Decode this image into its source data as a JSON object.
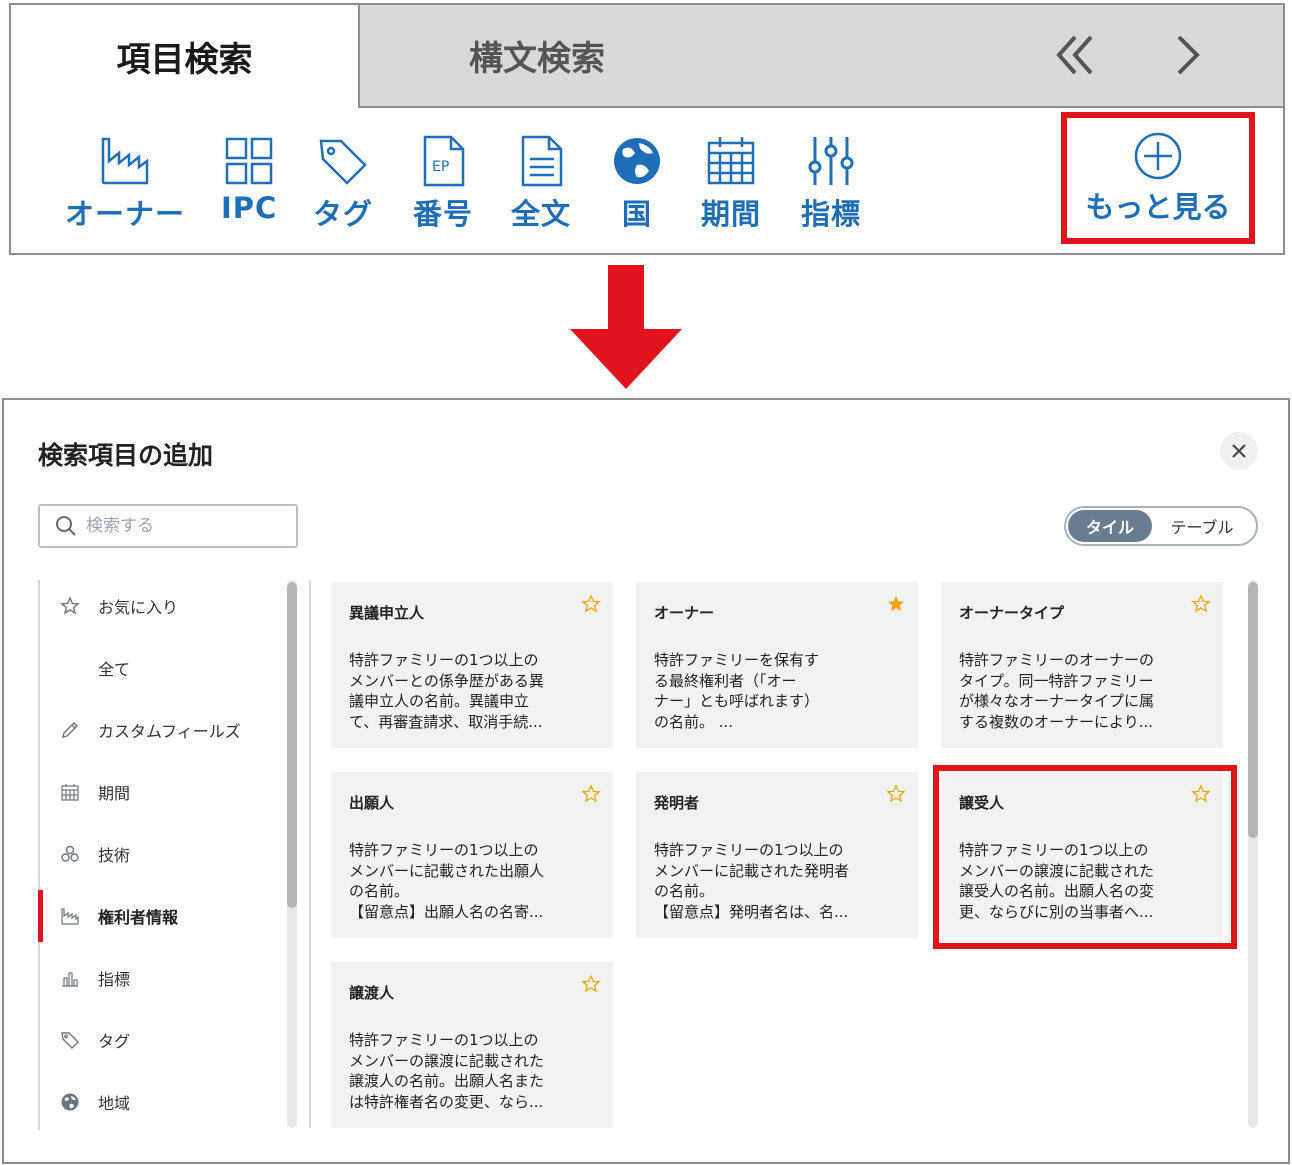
{
  "top_panel": {
    "tabs": [
      {
        "label": "項目検索",
        "active": true
      },
      {
        "label": "構文検索",
        "active": false
      }
    ],
    "tools": [
      {
        "label": "オーナー",
        "icon": "factory-icon"
      },
      {
        "label": "IPC",
        "icon": "grid-icon"
      },
      {
        "label": "タグ",
        "icon": "tag-icon"
      },
      {
        "label": "番号",
        "icon": "ep-document-icon"
      },
      {
        "label": "全文",
        "icon": "document-icon"
      },
      {
        "label": "国",
        "icon": "globe-icon"
      },
      {
        "label": "期間",
        "icon": "calendar-icon"
      },
      {
        "label": "指標",
        "icon": "sliders-icon"
      }
    ],
    "more": {
      "label": "もっと見る",
      "icon": "plus-circle-icon"
    }
  },
  "dialog": {
    "title": "検索項目の追加",
    "search_placeholder": "検索する",
    "view_toggle": {
      "tile": "タイル",
      "table": "テーブル",
      "selected": "タイル"
    },
    "sidebar": [
      {
        "label": "お気に入り",
        "icon": "star-icon"
      },
      {
        "label": "全て",
        "icon": ""
      },
      {
        "label": "カスタムフィールズ",
        "icon": "pencil-icon"
      },
      {
        "label": "期間",
        "icon": "calendar-icon"
      },
      {
        "label": "技術",
        "icon": "molecule-icon"
      },
      {
        "label": "権利者情報",
        "icon": "factory-icon",
        "active": true
      },
      {
        "label": "指標",
        "icon": "bar-chart-icon"
      },
      {
        "label": "タグ",
        "icon": "tag-icon"
      },
      {
        "label": "地域",
        "icon": "globe-icon"
      }
    ],
    "cards": [
      {
        "title": "異議申立人",
        "desc": "特許ファミリーの1つ以上の\nメンバーとの係争歴がある異\n議申立人の名前。異議申立\nて、再審査請求、取消手続...",
        "favorite": false
      },
      {
        "title": "オーナー",
        "desc": "特許ファミリーを保有す\nる最終権利者（「オー\nナー」とも呼ばれます）\nの名前。 ...",
        "favorite": true
      },
      {
        "title": "オーナータイプ",
        "desc": "特許ファミリーのオーナーの\nタイプ。同一特許ファミリー\nが様々なオーナータイプに属\nする複数のオーナーにより...",
        "favorite": false
      },
      {
        "title": "出願人",
        "desc": "特許ファミリーの1つ以上の\nメンバーに記載された出願人\nの名前。\n【留意点】出願人名の名寄...",
        "favorite": false
      },
      {
        "title": "発明者",
        "desc": "特許ファミリーの1つ以上の\nメンバーに記載された発明者\nの名前。\n【留意点】発明者名は、名...",
        "favorite": false
      },
      {
        "title": "譲受人",
        "desc": "特許ファミリーの1つ以上の\nメンバーの譲渡に記載された\n譲受人の名前。出願人名の変\n更、ならびに別の当事者へ...",
        "favorite": false
      },
      {
        "title": "譲渡人",
        "desc": "特許ファミリーの1つ以上の\nメンバーの譲渡に記載された\n譲渡人の名前。出願人名また\nは特許権者名の変更、なら...",
        "favorite": false
      }
    ]
  },
  "colors": {
    "accent_blue": "#1f6fb8",
    "highlight_red": "#e1141e",
    "star_gold": "#f0a500"
  }
}
